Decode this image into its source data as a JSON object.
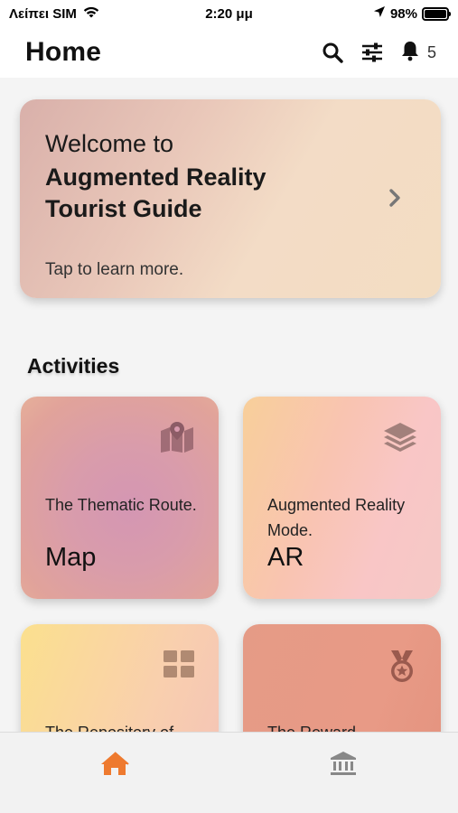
{
  "status_bar": {
    "carrier": "Λείπει SIM",
    "time": "2:20 μμ",
    "battery": "98%",
    "battery_level": 0.98
  },
  "header": {
    "title": "Home",
    "notification_count": "5",
    "icons": [
      "search-icon",
      "filter-sliders-icon",
      "bell-icon"
    ]
  },
  "welcome": {
    "line1": "Welcome to",
    "line2": "Augmented Reality",
    "line3": "Tourist Guide",
    "tap_text": "Tap to learn more."
  },
  "activities": {
    "title": "Activities",
    "tiles": [
      {
        "subtitle": "The Thematic Route.",
        "name": "Map",
        "icon": "map-pin-icon"
      },
      {
        "subtitle": "Augmented Reality Mode.",
        "name": "AR",
        "icon": "layers-icon"
      },
      {
        "subtitle": "The Repository of",
        "name": "",
        "icon": "grid-icon"
      },
      {
        "subtitle": "The Reward",
        "name": "",
        "icon": "medal-icon"
      }
    ]
  },
  "tab_bar": {
    "items": [
      {
        "icon": "home-icon",
        "active": true
      },
      {
        "icon": "museum-icon",
        "active": false
      }
    ],
    "active_color": "#ee7a2f",
    "inactive_color": "#888888"
  }
}
